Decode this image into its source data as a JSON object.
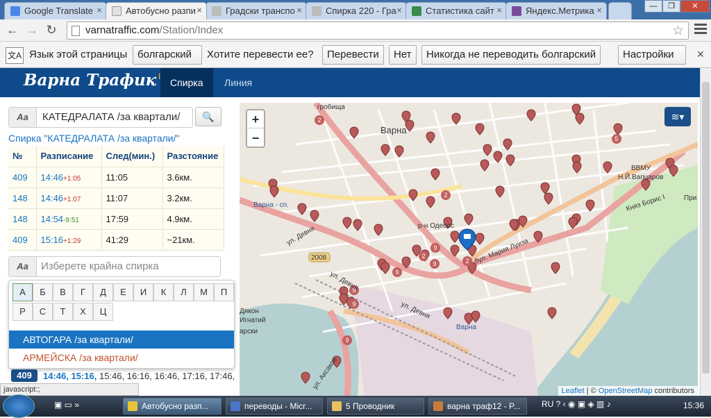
{
  "tabs": [
    {
      "label": "Google Translate",
      "color": "#4a86e8"
    },
    {
      "label": "Автобусно разпи",
      "color": "#e8e8e8",
      "active": true
    },
    {
      "label": "Градски транспо",
      "color": "#bbb"
    },
    {
      "label": "Спирка 220 - Гра",
      "color": "#bbb"
    },
    {
      "label": "Статистика сайт",
      "color": "#3a8a4a"
    },
    {
      "label": "Яндекс.Метрика",
      "color": "#7a4a9a"
    }
  ],
  "url": {
    "host": "varnatraffic.com",
    "path": "/Station/Index"
  },
  "translate_bar": {
    "prompt": "Язык этой страницы",
    "language": "болгарский",
    "question": "Хотите перевести ее?",
    "translate_button": "Перевести",
    "no_button": "Нет",
    "never_button": "Никогда не переводить болгарский",
    "settings_button": "Настройки"
  },
  "site": {
    "brand": "Варна Трафик",
    "beta": "beta",
    "nav": [
      "Спирка",
      "Линия"
    ]
  },
  "stop_search": {
    "addon": "Аа",
    "value": "КАТЕДРАЛАТА /за квартали/",
    "search_icon": "magnifier-icon"
  },
  "stop_title": "Спирка \"КАТЕДРАЛАТА /за квартали/\"",
  "schedule": {
    "headers": [
      "№",
      "Разписание",
      "След(мин.)",
      "Разстояние"
    ],
    "rows": [
      {
        "line": "409",
        "time": "14:46",
        "delay": "+1:05",
        "delay_type": "late",
        "next": "11:05",
        "distance": "3.6км."
      },
      {
        "line": "148",
        "time": "14:46",
        "delay": "+1:07",
        "delay_type": "late",
        "next": "11:07",
        "distance": "3.2км."
      },
      {
        "line": "148",
        "time": "14:54",
        "delay": "-9:51",
        "delay_type": "early",
        "next": "17:59",
        "distance": "4.9км."
      },
      {
        "line": "409",
        "time": "15:16",
        "delay": "+1:29",
        "delay_type": "late",
        "next": "41:29",
        "distance": "~21км."
      }
    ]
  },
  "end_stop": {
    "addon": "Аа",
    "placeholder": "Изберете крайна спирка"
  },
  "alphabet": {
    "row1": [
      "А",
      "Б",
      "В",
      "Г",
      "Д",
      "Е",
      "И",
      "К",
      "Л",
      "М",
      "П"
    ],
    "row2": [
      "Р",
      "С",
      "Т",
      "Х",
      "Ц"
    ],
    "selected": "А"
  },
  "stop_options": [
    "АВТОГАРА /за квартали/",
    "АРМЕЙСКА /за квартали/"
  ],
  "departures": {
    "line": "409",
    "bold_times": [
      "14:46,",
      "15:16,"
    ],
    "times": "15:46, 16:16, 16:46, 17:16, 17:46,"
  },
  "map": {
    "labels": {
      "varna": "Варна",
      "grobishta": "гробища",
      "vvmu": "ВВМУ",
      "vaptsarov": "Н.Й.Вапцаров",
      "odesos": "р-н Одесос",
      "varna_sp": "Варна - сп.",
      "varna2": "Варна",
      "knyaz": "Княз Борис I",
      "pri": "При",
      "maria": "бул. Мария Луиза",
      "devnya1": "ул. Девня",
      "devnya2": "ул. Девня",
      "devnya3": "ул. Девня",
      "road2008": "2008",
      "aksakov": "ул. Аксаков",
      "dyakon": "Дякон",
      "ignatii": "Игнатий",
      "skarsh": "арски",
      "pin_labels": [
        "2",
        "2",
        "2",
        "2",
        "5",
        "9",
        "9",
        "9",
        "9",
        "9",
        "9"
      ],
      "attr_leaflet": "Leaflet",
      "attr_sep": " | © ",
      "attr_osm": "OpenStreetMap",
      "attr_contrib": " contributors"
    },
    "zoom_in": "+",
    "zoom_out": "−"
  },
  "status_text": "javascript:;",
  "taskbar": {
    "items": [
      "Автобусно разп...",
      "переводы - Micr...",
      "5 Проводник",
      "варна траф12 - P..."
    ],
    "lang": "RU",
    "clock": "15:36"
  },
  "colors": {
    "header": "#0f4a8a",
    "link": "#1a74c2",
    "highlight": "#1a74c2"
  }
}
